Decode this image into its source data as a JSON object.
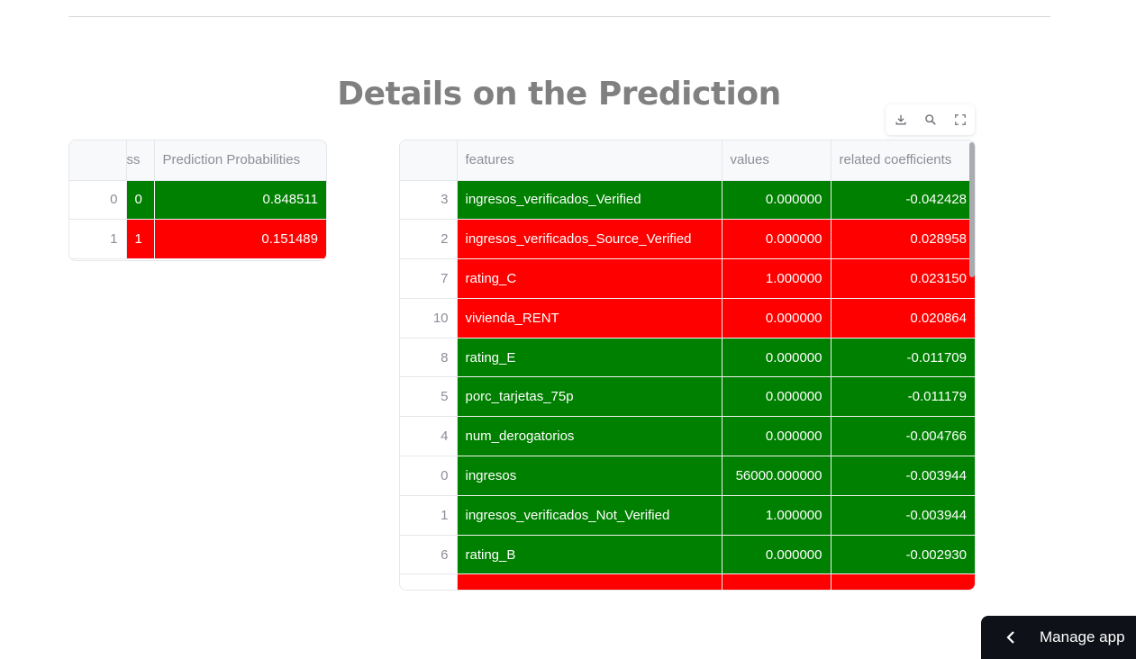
{
  "title": "Details on the Prediction",
  "toolbar": {
    "download_icon": "download-icon",
    "search_icon": "search-icon",
    "fullscreen_icon": "fullscreen-icon"
  },
  "colors": {
    "positive": "#008000",
    "negative": "#ff0000",
    "header_bg": "#f8f9fb",
    "title": "#808080"
  },
  "left_table": {
    "columns": [
      "ss",
      "Prediction Probabilities"
    ],
    "rows": [
      {
        "index": "0",
        "class": "0",
        "prob": "0.848511",
        "color": "g"
      },
      {
        "index": "1",
        "class": "1",
        "prob": "0.151489",
        "color": "r"
      }
    ]
  },
  "right_table": {
    "columns": [
      "features",
      "values",
      "related coefficients"
    ],
    "rows": [
      {
        "index": "3",
        "feature": "ingresos_verificados_Verified",
        "value": "0.000000",
        "coef": "-0.042428",
        "color": "g"
      },
      {
        "index": "2",
        "feature": "ingresos_verificados_Source_Verified",
        "value": "0.000000",
        "coef": "0.028958",
        "color": "r"
      },
      {
        "index": "7",
        "feature": "rating_C",
        "value": "1.000000",
        "coef": "0.023150",
        "color": "r"
      },
      {
        "index": "10",
        "feature": "vivienda_RENT",
        "value": "0.000000",
        "coef": "0.020864",
        "color": "r"
      },
      {
        "index": "8",
        "feature": "rating_E",
        "value": "0.000000",
        "coef": "-0.011709",
        "color": "g"
      },
      {
        "index": "5",
        "feature": "porc_tarjetas_75p",
        "value": "0.000000",
        "coef": "-0.011179",
        "color": "g"
      },
      {
        "index": "4",
        "feature": "num_derogatorios",
        "value": "0.000000",
        "coef": "-0.004766",
        "color": "g"
      },
      {
        "index": "0",
        "feature": "ingresos",
        "value": "56000.000000",
        "coef": "-0.003944",
        "color": "g"
      },
      {
        "index": "1",
        "feature": "ingresos_verificados_Not_Verified",
        "value": "1.000000",
        "coef": "-0.003944",
        "color": "g"
      },
      {
        "index": "6",
        "feature": "rating_B",
        "value": "0.000000",
        "coef": "-0.002930",
        "color": "g"
      },
      {
        "index": "",
        "feature": "",
        "value": "",
        "coef": "",
        "color": "r"
      }
    ]
  },
  "manage_app": {
    "label": "Manage app",
    "icon": "chevron-left-icon"
  }
}
